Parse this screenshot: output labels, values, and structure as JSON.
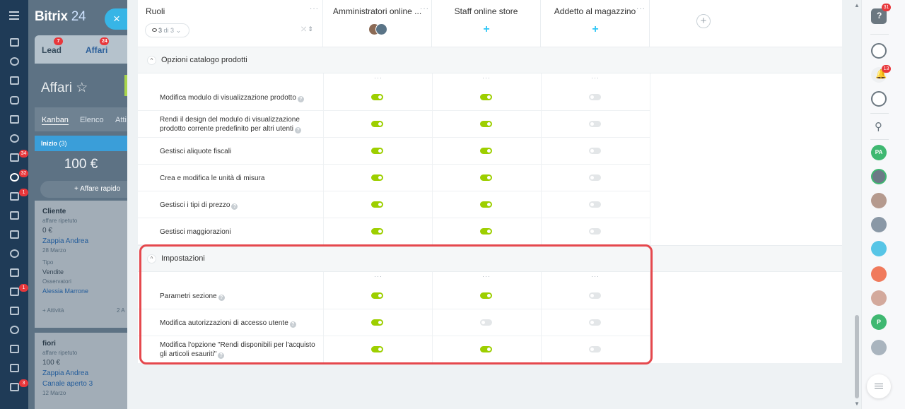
{
  "leftnav": {
    "badges": [
      "34",
      "32",
      "1",
      "1",
      "3"
    ]
  },
  "crm": {
    "logo_main": "Bitrix",
    "logo_num": "24",
    "close_symbol": "×",
    "tabs": [
      {
        "label": "Lead",
        "badge": "7"
      },
      {
        "label": "Affari",
        "badge": "24"
      }
    ],
    "page_title": "Affari",
    "views": [
      "Kanban",
      "Elenco",
      "Atti"
    ],
    "column_title": "Inizio",
    "column_count": "(3)",
    "column_sum": "100 €",
    "quick_deal": "+ Affare rapido",
    "cards": [
      {
        "title": "Cliente",
        "subtitle": "affare ripetuto",
        "amount": "0 €",
        "contact": "Zappia Andrea",
        "date": "28 Marzo",
        "type_label": "Tipo",
        "type_value": "Vendite",
        "observers_label": "Osservatori",
        "observers_value": "Alessia Marrone",
        "activity": "+ Attività",
        "activity_right": "2 A"
      },
      {
        "title": "fiori",
        "subtitle": "affare ripetuto",
        "amount": "100 €",
        "contact": "Zappia Andrea",
        "channel": "Canale aperto 3",
        "date": "12 Marzo"
      }
    ]
  },
  "header": {
    "roles_label": "Ruoli",
    "filter_count": "3",
    "filter_of": "di 3",
    "role_columns": [
      {
        "name": "Amministratori online ..."
      },
      {
        "name": "Staff online store"
      },
      {
        "name": "Addetto al magazzino"
      }
    ]
  },
  "sections": [
    {
      "title": "Opzioni catalogo prodotti",
      "rows": [
        {
          "label": "Modifica modulo di visualizzazione prodotto",
          "help": true,
          "values": [
            true,
            true,
            false
          ]
        },
        {
          "label": "Rendi il design del modulo di visualizzazione prodotto corrente predefinito per altri utenti",
          "help": true,
          "values": [
            true,
            true,
            false
          ]
        },
        {
          "label": "Gestisci aliquote fiscali",
          "help": false,
          "values": [
            true,
            true,
            false
          ]
        },
        {
          "label": "Crea e modifica le unità di misura",
          "help": false,
          "values": [
            true,
            true,
            false
          ]
        },
        {
          "label": "Gestisci i tipi di prezzo",
          "help": true,
          "values": [
            true,
            true,
            false
          ]
        },
        {
          "label": "Gestisci maggiorazioni",
          "help": false,
          "values": [
            true,
            true,
            false
          ]
        }
      ]
    },
    {
      "title": "Impostazioni",
      "highlighted": true,
      "rows": [
        {
          "label": "Parametri sezione",
          "help": true,
          "values": [
            true,
            true,
            false
          ]
        },
        {
          "label": "Modifica autorizzazioni di accesso utente",
          "help": true,
          "values": [
            true,
            false,
            false
          ]
        },
        {
          "label": "Modifica l'opzione \"Rendi disponibili per l'acquisto gli articoli esauriti\"",
          "help": true,
          "values": [
            true,
            true,
            false
          ]
        }
      ]
    }
  ],
  "rightbar": {
    "help_badge": "31",
    "bell_badge": "13",
    "avatar_initials": [
      "PA",
      "P"
    ]
  },
  "colors": {
    "toggle_on": "#9dcf00",
    "toggle_off": "#e3e6e8",
    "highlight": "#e5484d",
    "accent": "#2fc6f6"
  }
}
